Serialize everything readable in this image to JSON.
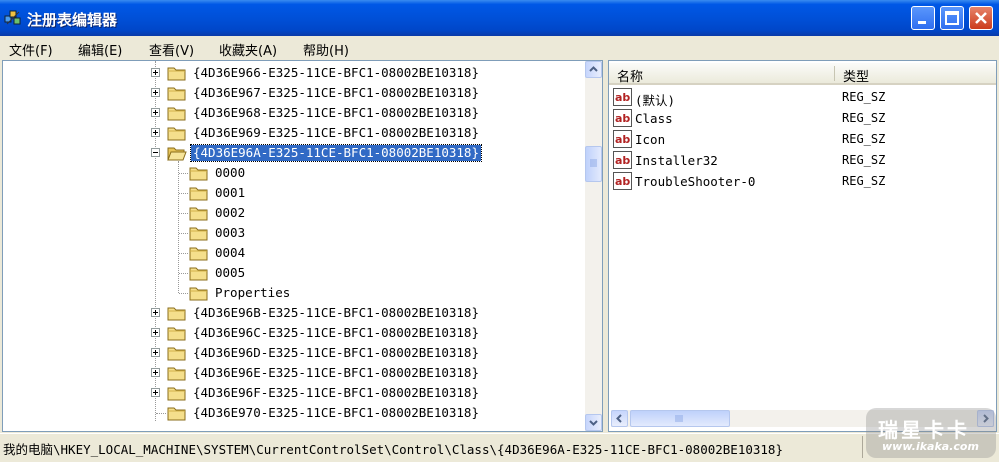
{
  "window": {
    "title": "注册表编辑器",
    "icon": "regedit-icon",
    "controls": {
      "minimize": "minimize-icon",
      "maximize": "maximize-icon",
      "close": "close-icon"
    }
  },
  "menu": [
    "文件(F)",
    "编辑(E)",
    "查看(V)",
    "收藏夹(A)",
    "帮助(H)"
  ],
  "tree": {
    "rows": [
      {
        "label": "{4D36E966-E325-11CE-BFC1-08002BE10318}",
        "expander": "plus"
      },
      {
        "label": "{4D36E967-E325-11CE-BFC1-08002BE10318}",
        "expander": "plus"
      },
      {
        "label": "{4D36E968-E325-11CE-BFC1-08002BE10318}",
        "expander": "plus"
      },
      {
        "label": "{4D36E969-E325-11CE-BFC1-08002BE10318}",
        "expander": "plus"
      },
      {
        "label": "{4D36E96A-E325-11CE-BFC1-08002BE10318}",
        "expander": "minus",
        "selected": true,
        "open": true
      },
      {
        "label": "0000",
        "child": true
      },
      {
        "label": "0001",
        "child": true
      },
      {
        "label": "0002",
        "child": true
      },
      {
        "label": "0003",
        "child": true
      },
      {
        "label": "0004",
        "child": true
      },
      {
        "label": "0005",
        "child": true
      },
      {
        "label": "Properties",
        "child": true
      },
      {
        "label": "{4D36E96B-E325-11CE-BFC1-08002BE10318}",
        "expander": "plus"
      },
      {
        "label": "{4D36E96C-E325-11CE-BFC1-08002BE10318}",
        "expander": "plus"
      },
      {
        "label": "{4D36E96D-E325-11CE-BFC1-08002BE10318}",
        "expander": "plus"
      },
      {
        "label": "{4D36E96E-E325-11CE-BFC1-08002BE10318}",
        "expander": "plus"
      },
      {
        "label": "{4D36E96F-E325-11CE-BFC1-08002BE10318}",
        "expander": "plus"
      },
      {
        "label": "{4D36E970-E325-11CE-BFC1-08002BE10318}",
        "expander": "none"
      }
    ]
  },
  "values": {
    "columns": {
      "name": "名称",
      "type": "类型"
    },
    "rows": [
      {
        "name": "(默认)",
        "type": "REG_SZ"
      },
      {
        "name": "Class",
        "type": "REG_SZ"
      },
      {
        "name": "Icon",
        "type": "REG_SZ"
      },
      {
        "name": "Installer32",
        "type": "REG_SZ"
      },
      {
        "name": "TroubleShooter-0",
        "type": "REG_SZ"
      }
    ]
  },
  "statusbar": {
    "path": "我的电脑\\HKEY_LOCAL_MACHINE\\SYSTEM\\CurrentControlSet\\Control\\Class\\{4D36E96A-E325-11CE-BFC1-08002BE10318}"
  },
  "watermark": {
    "text": "瑞星卡卡",
    "url": "www.ikaka.com"
  },
  "colors": {
    "selection": "#316ac5",
    "titlebar": "#0054e3",
    "folder": "#f5df8c"
  }
}
